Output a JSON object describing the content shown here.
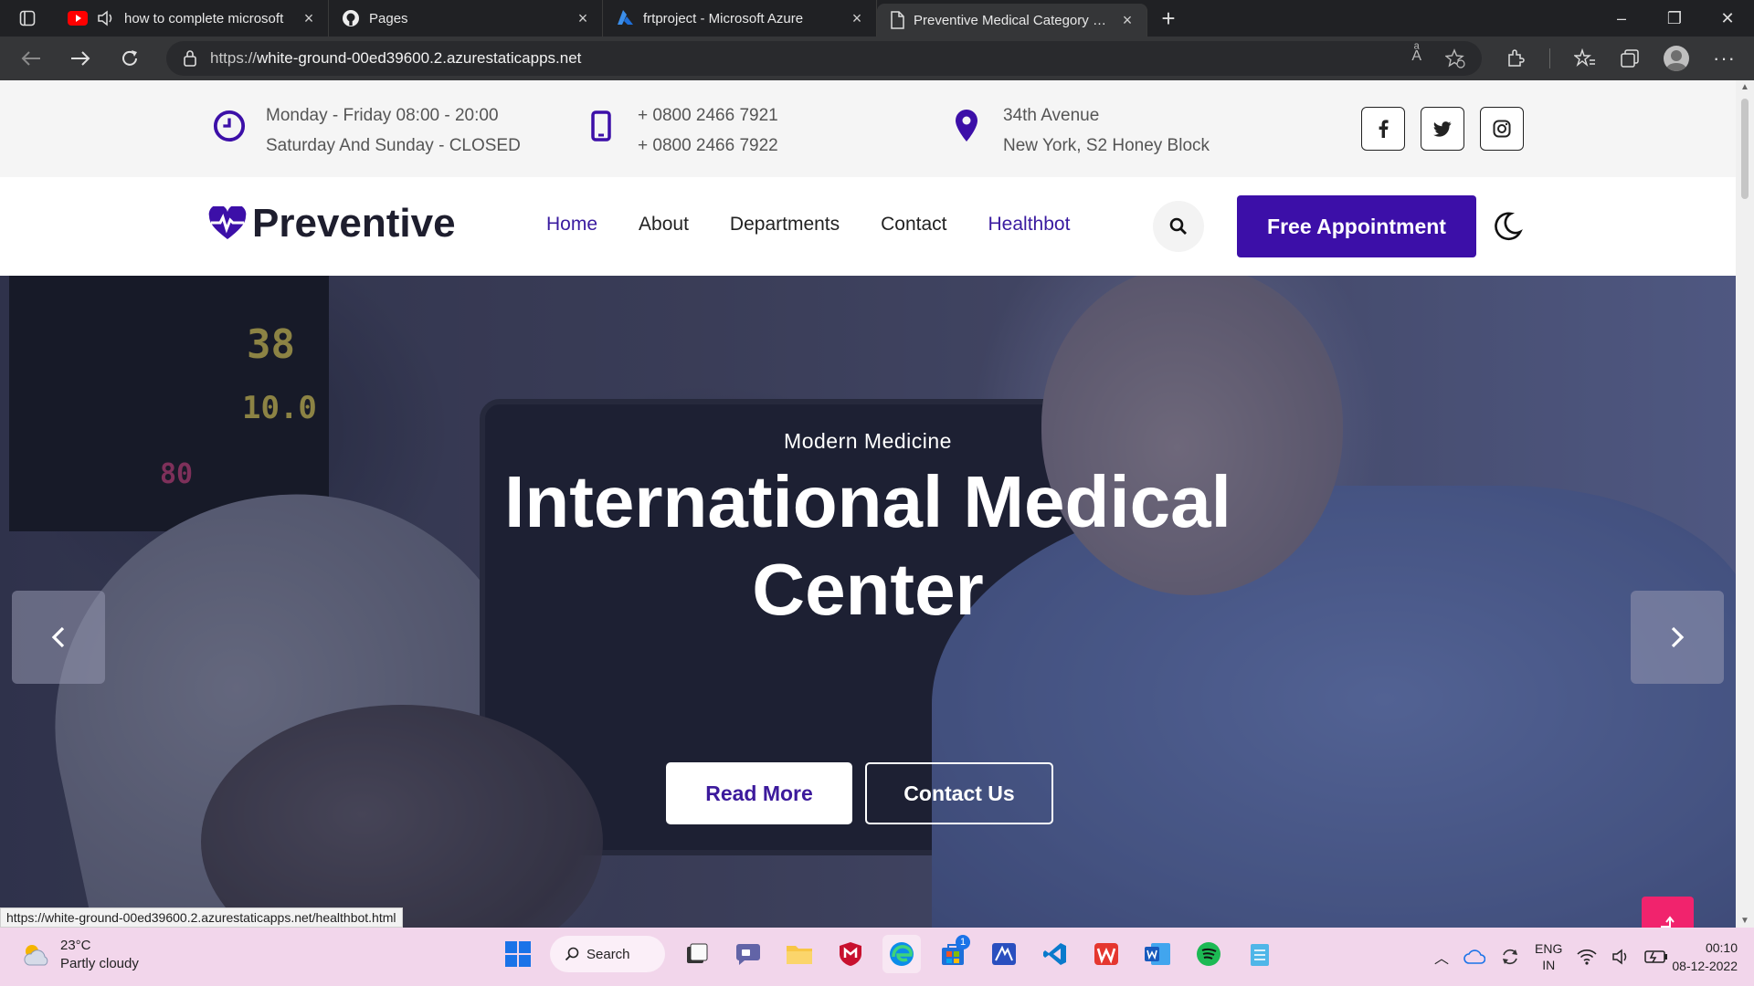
{
  "browser": {
    "tabs": [
      {
        "title": "how to complete microsoft",
        "icon": "youtube-icon",
        "audio": true
      },
      {
        "title": "Pages",
        "icon": "github-icon"
      },
      {
        "title": "frtproject - Microsoft Azure",
        "icon": "azure-icon"
      },
      {
        "title": "Preventive Medical Category Boo",
        "icon": "page-icon",
        "active": true
      }
    ],
    "url_prefix": "https://",
    "url_host": "white-ground-00ed39600.2.azurestaticapps.net",
    "status_url": "https://white-ground-00ed39600.2.azurestaticapps.net/healthbot.html"
  },
  "site": {
    "hours": {
      "line1": "Monday - Friday 08:00 - 20:00",
      "line2": "Saturday And Sunday - CLOSED"
    },
    "phone": {
      "line1": "+ 0800 2466 7921",
      "line2": "+ 0800 2466 7922"
    },
    "address": {
      "line1": "34th Avenue",
      "line2": "New York, S2 Honey Block"
    },
    "logo": "Preventive",
    "menu": [
      "Home",
      "About",
      "Departments",
      "Contact",
      "Healthbot"
    ],
    "appointment_label": "Free Appointment",
    "hero": {
      "subtitle": "Modern Medicine",
      "title_line1": "International Medical",
      "title_line2": "Center",
      "read_more": "Read More",
      "contact_us": "Contact Us"
    },
    "accent": "#3c0fa8",
    "back_to_top_color": "#f1236d"
  },
  "taskbar": {
    "temperature": "23°C",
    "weather": "Partly cloudy",
    "search_label": "Search",
    "lang1": "ENG",
    "lang2": "IN",
    "time": "00:10",
    "date": "08-12-2022",
    "badge": "1"
  }
}
